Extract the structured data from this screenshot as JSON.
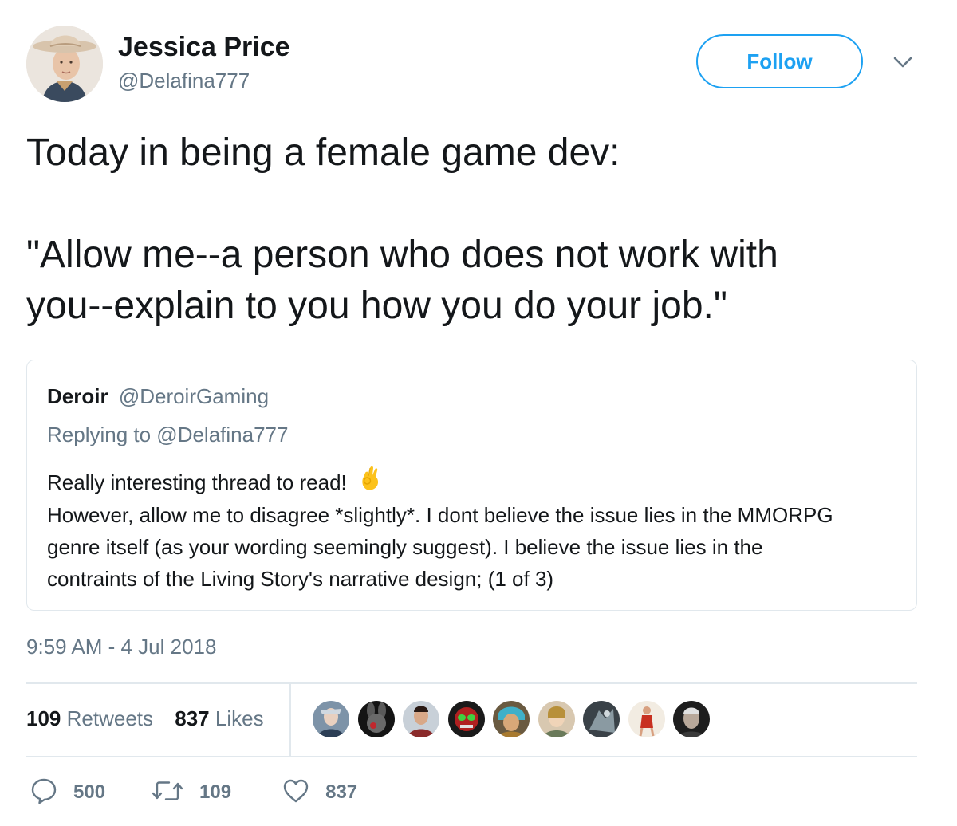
{
  "author": {
    "name": "Jessica Price",
    "handle": "@Delafina777"
  },
  "header": {
    "follow_label": "Follow",
    "more_icon": "chevron-down-icon"
  },
  "tweet": {
    "line1": "Today in being a female game dev:",
    "line2": "\"Allow me--a person who does not work with",
    "line3": "you--explain to you how you do your job.\""
  },
  "quoted_tweet": {
    "author_name": "Deroir",
    "author_handle": "@DeroirGaming",
    "replying_to": "Replying to @Delafina777",
    "lines": [
      "Really interesting thread to read!",
      "However, allow me to disagree *slightly*. I dont believe the issue lies in the MMORPG",
      "genre itself (as your wording seemingly suggest). I believe the issue lies in the",
      "contraints of the Living Story's narrative design; (1 of 3)"
    ],
    "emoji": "ok-hand-emoji"
  },
  "timestamp": "9:59 AM - 4 Jul 2018",
  "stats": {
    "retweets_count": "109",
    "retweets_label": "Retweets",
    "likes_count": "837",
    "likes_label": "Likes"
  },
  "actions": {
    "reply_count": "500",
    "retweet_count": "109",
    "like_count": "837"
  },
  "colors": {
    "accent": "#1da1f2",
    "secondary_text": "#657786",
    "primary_text": "#14171a",
    "border": "#e1e8ed"
  }
}
